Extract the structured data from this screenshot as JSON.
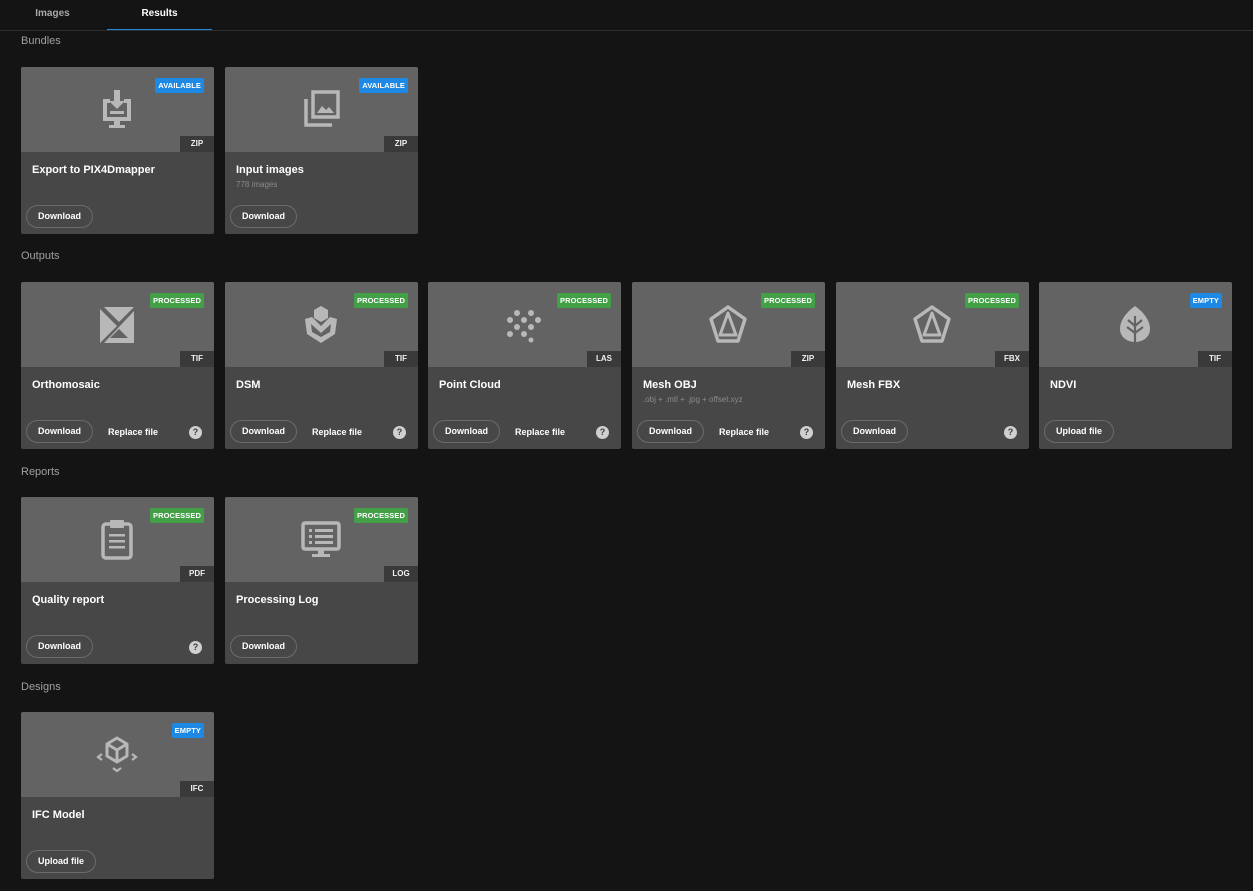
{
  "tabs": [
    {
      "label": "Images"
    },
    {
      "label": "Results"
    }
  ],
  "colors": {
    "available": "#1e88e5",
    "processed": "#43a047",
    "empty": "#1e88e5",
    "active_tab_underline": "#1e88e5"
  },
  "sections": {
    "bundles": "Bundles",
    "outputs": "Outputs",
    "reports": "Reports",
    "designs": "Designs"
  },
  "cards": {
    "export": {
      "status": "AVAILABLE",
      "format": "ZIP",
      "title": "Export to PIX4Dmapper",
      "icon": "download-monitor-icon",
      "primary": "Download"
    },
    "input_images": {
      "status": "AVAILABLE",
      "format": "ZIP",
      "title": "Input images",
      "subtitle": "778 images",
      "icon": "image-library-icon",
      "primary": "Download"
    },
    "ortho": {
      "status": "PROCESSED",
      "format": "TIF",
      "title": "Orthomosaic",
      "icon": "orthomosaic-icon",
      "primary": "Download",
      "secondary": "Replace file",
      "help": "?"
    },
    "dsm": {
      "status": "PROCESSED",
      "format": "TIF",
      "title": "DSM",
      "icon": "dsm-icon",
      "primary": "Download",
      "secondary": "Replace file",
      "help": "?"
    },
    "point_cloud": {
      "status": "PROCESSED",
      "format": "LAS",
      "title": "Point Cloud",
      "icon": "point-cloud-icon",
      "primary": "Download",
      "secondary": "Replace file",
      "help": "?"
    },
    "mesh_obj": {
      "status": "PROCESSED",
      "format": "ZIP",
      "title": "Mesh OBJ",
      "subtitle": ".obj + .mtl + .jpg + offset.xyz",
      "icon": "mesh-icon",
      "primary": "Download",
      "secondary": "Replace file",
      "help": "?"
    },
    "mesh_fbx": {
      "status": "PROCESSED",
      "format": "FBX",
      "title": "Mesh FBX",
      "icon": "mesh-icon",
      "primary": "Download",
      "help": "?"
    },
    "ndvi": {
      "status": "EMPTY",
      "format": "TIF",
      "title": "NDVI",
      "icon": "leaf-icon",
      "primary": "Upload file"
    },
    "quality": {
      "status": "PROCESSED",
      "format": "PDF",
      "title": "Quality report",
      "icon": "clipboard-report-icon",
      "primary": "Download",
      "help": "?"
    },
    "log": {
      "status": "PROCESSED",
      "format": "LOG",
      "title": "Processing Log",
      "icon": "log-monitor-icon",
      "primary": "Download"
    },
    "ifc": {
      "status": "EMPTY",
      "format": "IFC",
      "title": "IFC Model",
      "icon": "ifc-cube-icon",
      "primary": "Upload file"
    }
  }
}
